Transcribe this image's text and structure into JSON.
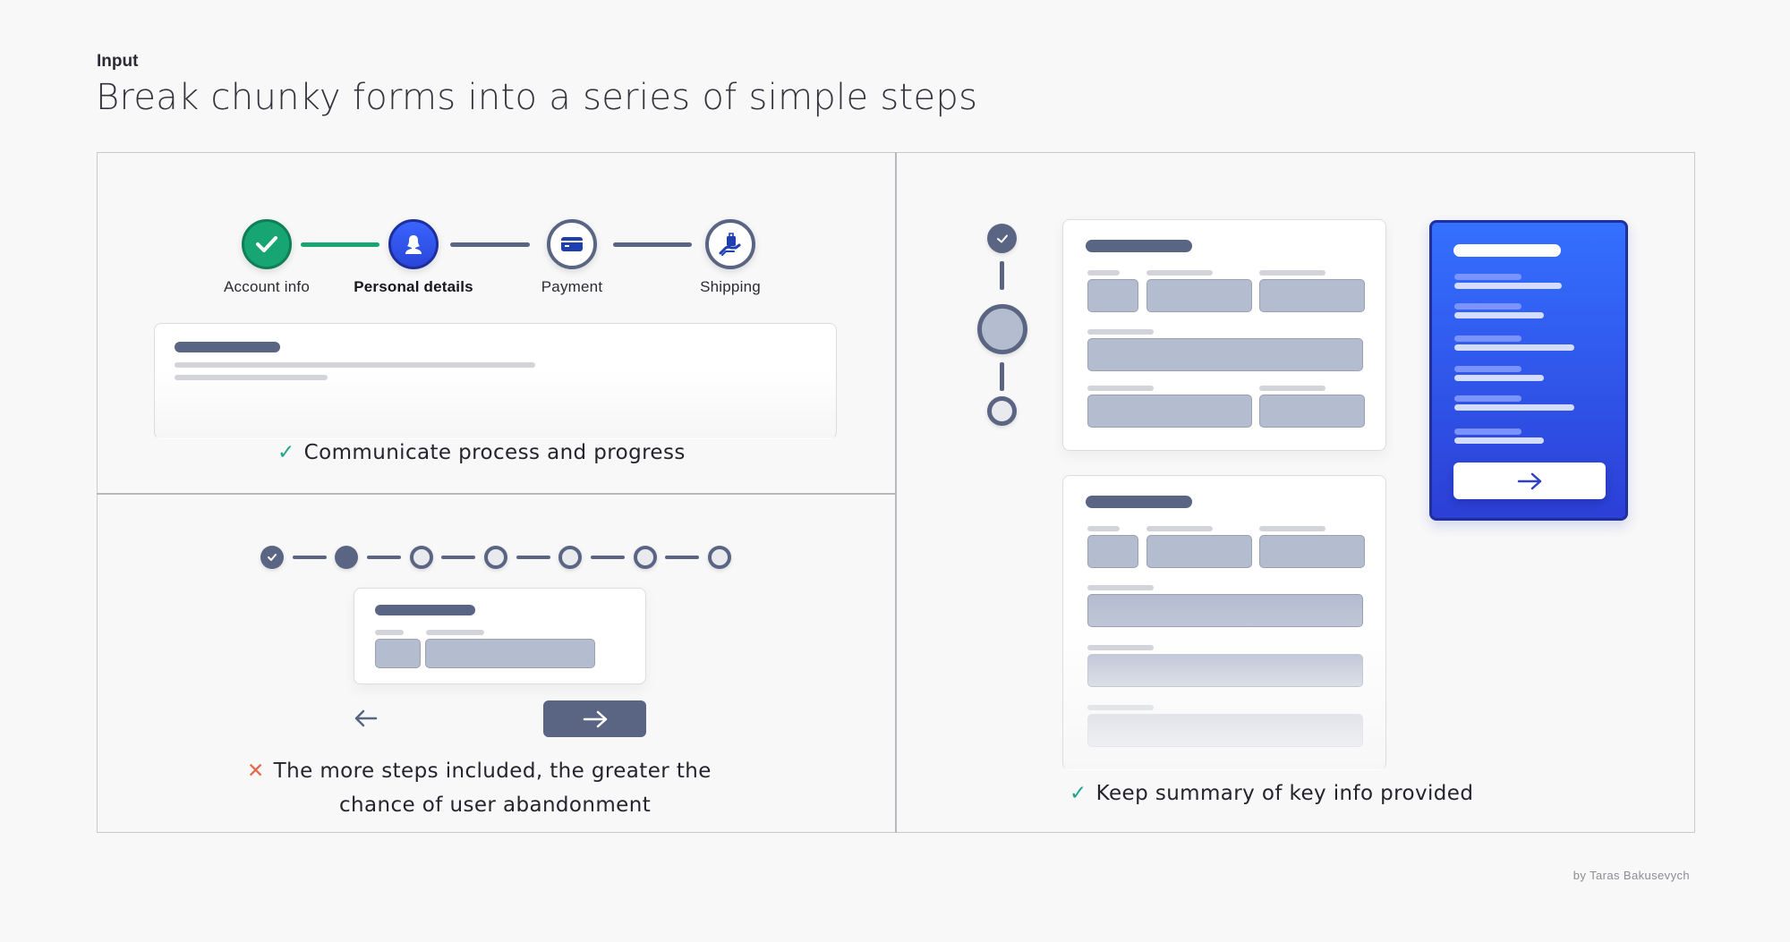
{
  "header": {
    "kicker": "Input",
    "title": "Break chunky forms into a series of simple steps"
  },
  "panel_progress": {
    "steps": [
      {
        "label": "Account info",
        "state": "done",
        "icon": "check-icon"
      },
      {
        "label": "Personal details",
        "state": "active",
        "icon": "person-icon"
      },
      {
        "label": "Payment",
        "state": "todo",
        "icon": "credit-card-icon"
      },
      {
        "label": "Shipping",
        "state": "todo",
        "icon": "hand-package-icon"
      }
    ],
    "caption": "Communicate process and progress",
    "caption_type": "positive"
  },
  "panel_many_steps": {
    "step_count": 7,
    "completed_steps": 1,
    "current_step": 2,
    "back_icon": "arrow-left-icon",
    "next_icon": "arrow-right-icon",
    "caption_line1": "The more steps included, the greater the",
    "caption_line2": "chance of user abandonment",
    "caption_type": "negative"
  },
  "panel_summary": {
    "vertical_steps": [
      "done",
      "current",
      "todo"
    ],
    "summary_next_icon": "arrow-right-icon",
    "caption": "Keep summary of key info provided",
    "caption_type": "positive"
  },
  "colors": {
    "success": "#17a673",
    "active": "#2f4fe0",
    "neutral": "#5a6584",
    "positive_mark": "#1fa38a",
    "negative_mark": "#e26a46"
  },
  "footer": {
    "attribution": "by Taras Bakusevych"
  },
  "icons": {
    "ok": "✓",
    "bad": "✕"
  }
}
